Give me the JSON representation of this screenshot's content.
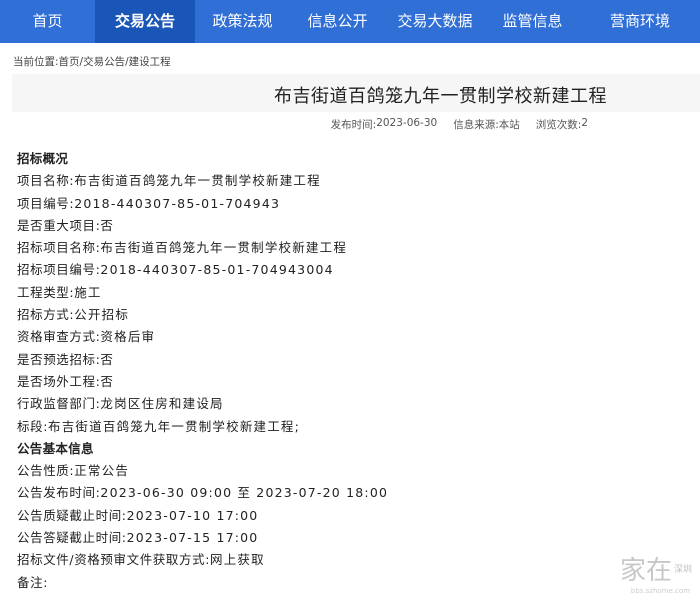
{
  "nav": {
    "items": [
      {
        "label": "首页",
        "width": 95
      },
      {
        "label": "交易公告",
        "width": 100,
        "active": true
      },
      {
        "label": "政策法规",
        "width": 95
      },
      {
        "label": "信息公开",
        "width": 95
      },
      {
        "label": "交易大数据",
        "width": 100
      },
      {
        "label": "监管信息",
        "width": 95
      },
      {
        "label": "营商环境",
        "width": 120
      }
    ],
    "color": "#2f6fd6",
    "active_color": "#1a55b8"
  },
  "breadcrumb": {
    "label": "当前位置:",
    "path": "首页/交易公告/建设工程"
  },
  "article": {
    "title": "布吉街道百鸽笼九年一贯制学校新建工程",
    "publish_label": "发布时间:",
    "publish_date": "2023-06-30",
    "source_label": "信息来源:",
    "source": "本站",
    "views_label": "浏览次数:",
    "views": "2"
  },
  "rows": [
    {
      "label": "招标概况",
      "value": "",
      "section": true
    },
    {
      "label": "项目名称:",
      "value": "布吉街道百鸽笼九年一贯制学校新建工程"
    },
    {
      "label": "项目编号:",
      "value": "2018-440307-85-01-704943"
    },
    {
      "label": "是否重大项目:",
      "value": "否"
    },
    {
      "label": "招标项目名称:",
      "value": "布吉街道百鸽笼九年一贯制学校新建工程"
    },
    {
      "label": "招标项目编号:",
      "value": "2018-440307-85-01-704943004"
    },
    {
      "label": "工程类型:",
      "value": "施工"
    },
    {
      "label": "招标方式:",
      "value": "公开招标"
    },
    {
      "label": "资格审查方式:",
      "value": "资格后审"
    },
    {
      "label": "是否预选招标:",
      "value": "否"
    },
    {
      "label": "是否场外工程:",
      "value": "否"
    },
    {
      "label": "行政监督部门:",
      "value": "龙岗区住房和建设局"
    },
    {
      "label": "标段:",
      "value": "布吉街道百鸽笼九年一贯制学校新建工程;"
    },
    {
      "label": "公告基本信息",
      "value": "",
      "section": true
    },
    {
      "label": "公告性质:",
      "value": "正常公告"
    },
    {
      "label": "公告发布时间:",
      "value": "2023-06-30 09:00 至 2023-07-20 18:00"
    },
    {
      "label": "公告质疑截止时间:",
      "value": "2023-07-10 17:00"
    },
    {
      "label": "公告答疑截止时间:",
      "value": "2023-07-15 17:00"
    },
    {
      "label": "招标文件/资格预审文件获取方式:",
      "value": "网上获取"
    },
    {
      "label": "备注:",
      "value": ""
    }
  ],
  "watermark": {
    "main": "家在",
    "sub": "深圳",
    "url": "bbs.szhome.com"
  }
}
